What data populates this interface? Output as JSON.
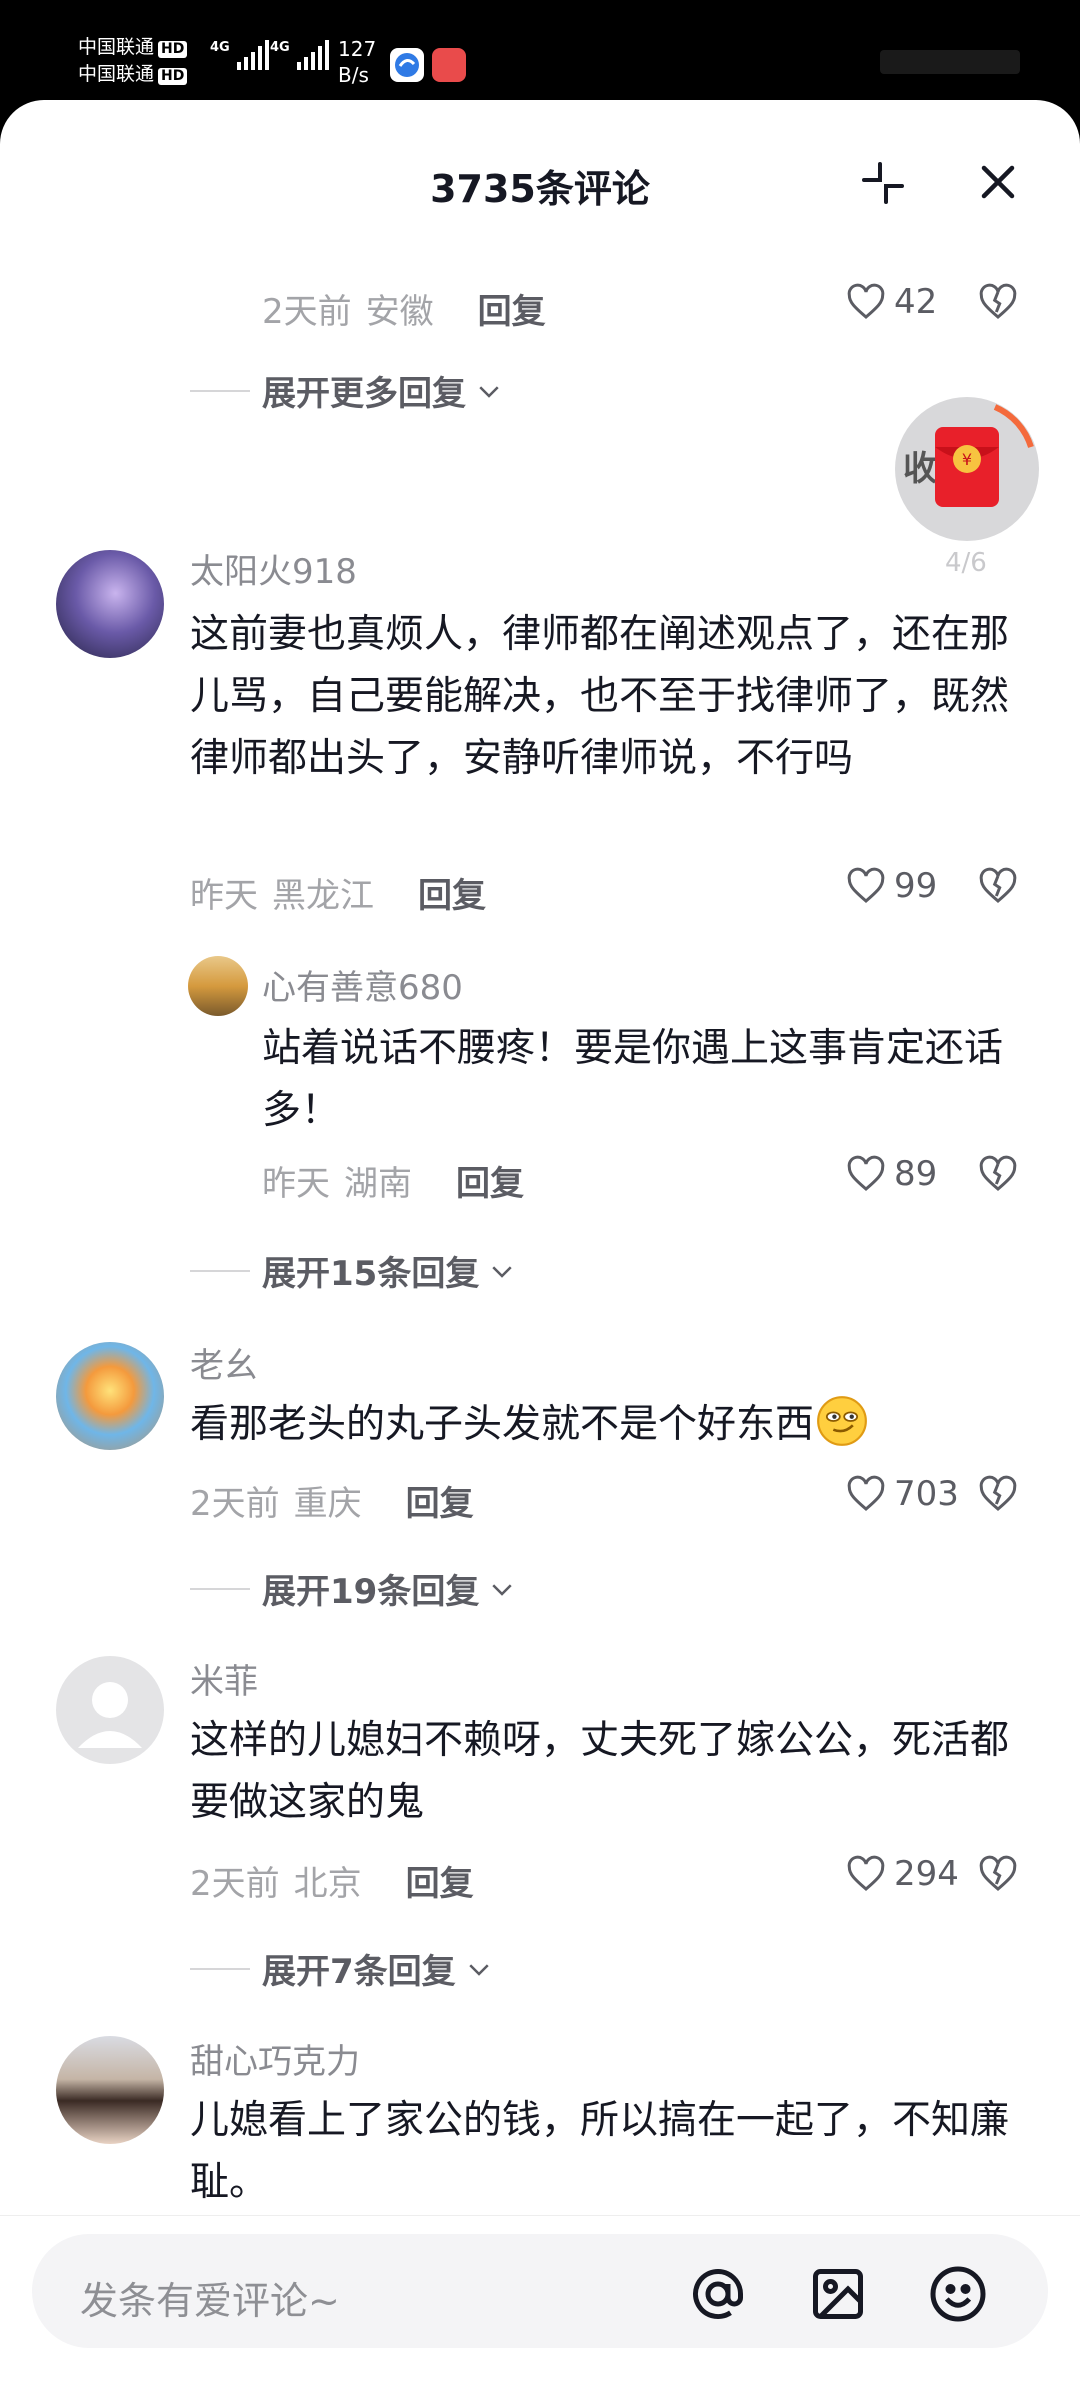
{
  "status_bar": {
    "carrier1": "中国联通",
    "carrier2": "中国联通",
    "hd": "HD",
    "network1": "4G",
    "network2": "4G",
    "speed_value": "127",
    "speed_unit": "B/s"
  },
  "header": {
    "title": "3735条评论"
  },
  "floating": {
    "redpacket_label": "收",
    "progress": "4/6"
  },
  "comments": [
    {
      "time": "2天前",
      "location": "安徽",
      "reply": "回复",
      "likes": "42",
      "expand": "展开更多回复"
    },
    {
      "username": "太阳火918",
      "content": "这前妻也真烦人，律师都在阐述观点了，还在那儿骂，自己要能解决，也不至于找律师了，既然律师都出头了，安静听律师说，不行吗",
      "time": "昨天",
      "location": "黑龙江",
      "reply": "回复",
      "likes": "99",
      "sub": {
        "username": "心有善意680",
        "content": "站着说话不腰疼！要是你遇上这事肯定还话多！",
        "time": "昨天",
        "location": "湖南",
        "reply": "回复",
        "likes": "89"
      },
      "expand": "展开15条回复"
    },
    {
      "username": "老幺",
      "content": "看那老头的丸子头发就不是个好东西",
      "time": "2天前",
      "location": "重庆",
      "reply": "回复",
      "likes": "703",
      "expand": "展开19条回复"
    },
    {
      "username": "米菲",
      "content": "这样的儿媳妇不赖呀，丈夫死了嫁公公，死活都要做这家的鬼",
      "time": "2天前",
      "location": "北京",
      "reply": "回复",
      "likes": "294",
      "expand": "展开7条回复"
    },
    {
      "username": "甜心巧克力",
      "content": "儿媳看上了家公的钱，所以搞在一起了，不知廉耻。"
    }
  ],
  "input": {
    "placeholder": "发条有爱评论~"
  },
  "icons": {
    "collapse": "collapse-icon",
    "close": "close-icon",
    "like": "heart-icon",
    "dislike": "broken-heart-icon",
    "chevron": "chevron-down-icon",
    "at": "at-icon",
    "image": "image-icon",
    "emoji": "emoji-icon"
  },
  "colors": {
    "primary_text": "#161823",
    "secondary_text": "#8a8b91",
    "redpacket": "#e8202a"
  }
}
